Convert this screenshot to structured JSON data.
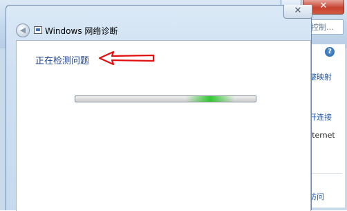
{
  "background_window": {
    "search_placeholder": "控制...",
    "help_glyph": "?",
    "close_glyph": "✕",
    "links": [
      "整映射",
      "开连接",
      "访问"
    ],
    "text": "Internet"
  },
  "dialog": {
    "title": "Windows 网络诊断",
    "close_glyph": "✕",
    "back_glyph": "◀",
    "status": "正在检测问题",
    "progress": "indeterminate"
  },
  "colors": {
    "status_text": "#1a3f8f",
    "arrow": "#e01010",
    "progress_glow": "#28c828"
  }
}
